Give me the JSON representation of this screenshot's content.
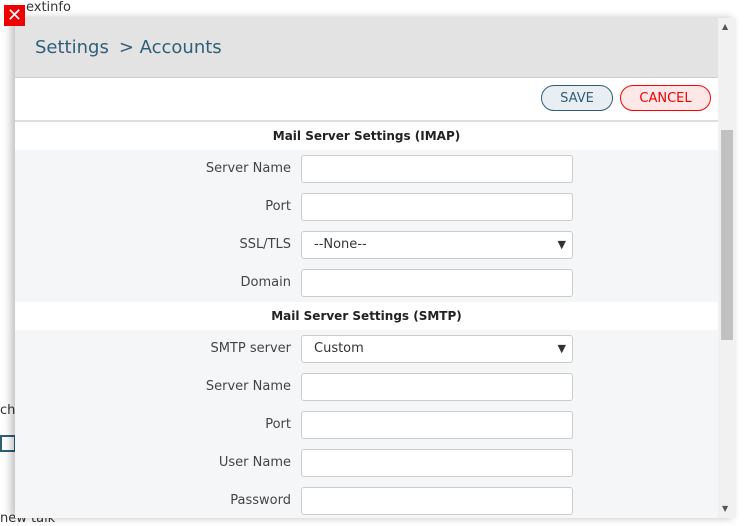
{
  "background": {
    "text1": "extinfo",
    "text2": "ch",
    "text3": "new talk"
  },
  "header": {
    "title": "Settings",
    "breadcrumb": "> Accounts"
  },
  "toolbar": {
    "save_label": "SAVE",
    "cancel_label": "CANCEL"
  },
  "imap": {
    "title": "Mail Server Settings (IMAP)",
    "server_name": "Server Name",
    "port": "Port",
    "ssl": "SSL/TLS",
    "ssl_value": "--None--",
    "domain": "Domain"
  },
  "smtp": {
    "title": "Mail Server Settings (SMTP)",
    "smtp_server": "SMTP server",
    "smtp_server_value": "Custom",
    "server_name": "Server Name",
    "port": "Port",
    "user_name": "User Name",
    "password": "Password"
  }
}
